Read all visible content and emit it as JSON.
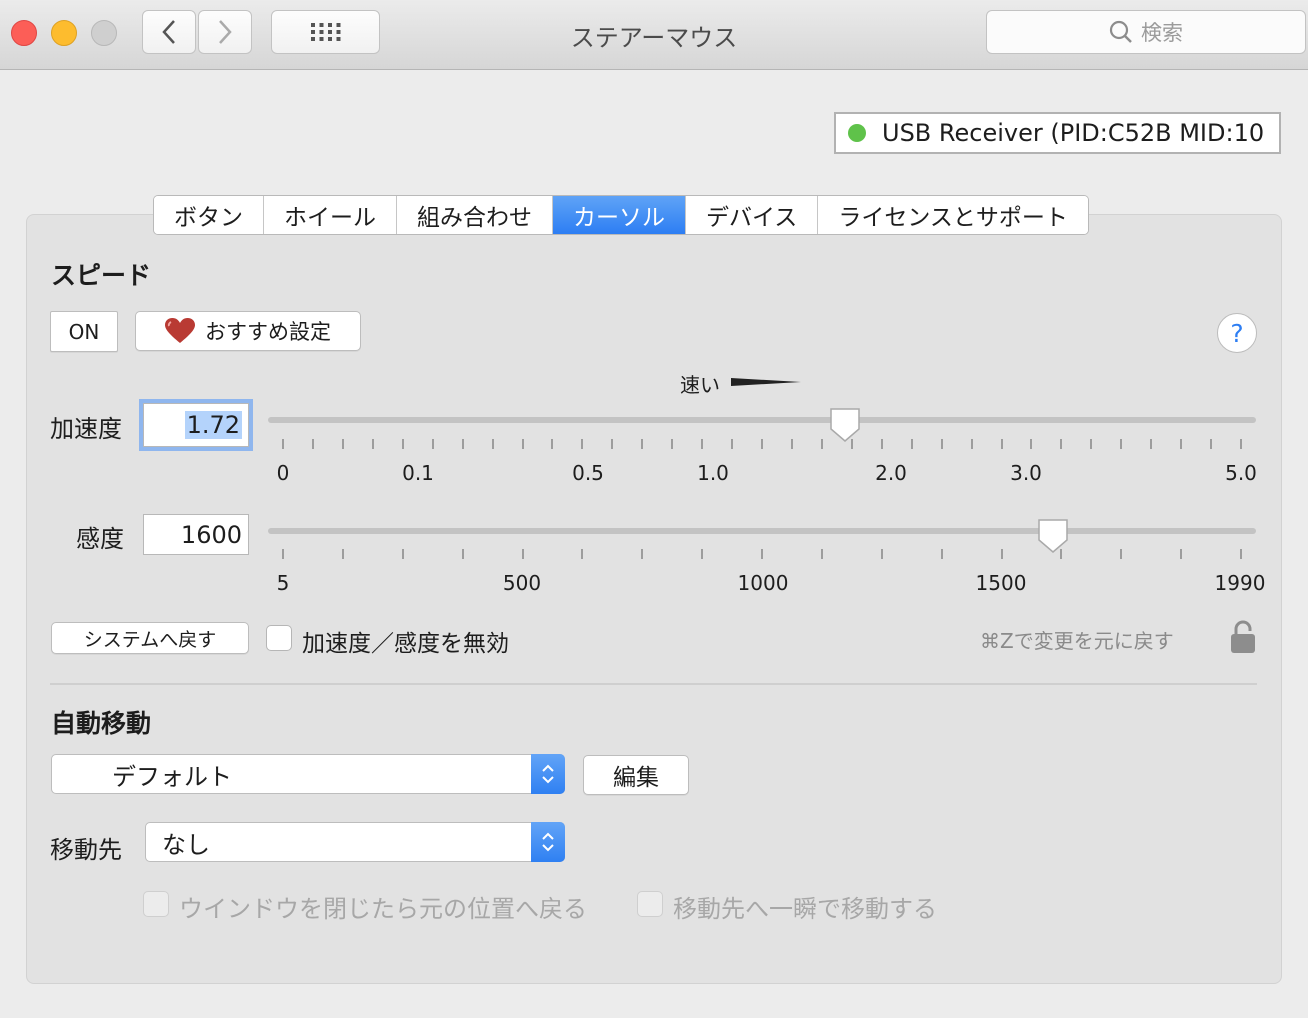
{
  "window": {
    "title": "ステアーマウス",
    "search_placeholder": "検索"
  },
  "device": {
    "label": "USB Receiver (PID:C52B MID:10",
    "status_color": "#5fc24a"
  },
  "tabs": [
    {
      "label": "ボタン",
      "active": false
    },
    {
      "label": "ホイール",
      "active": false
    },
    {
      "label": "組み合わせ",
      "active": false
    },
    {
      "label": "カーソル",
      "active": true
    },
    {
      "label": "デバイス",
      "active": false
    },
    {
      "label": "ライセンスとサポート",
      "active": false
    }
  ],
  "speed": {
    "heading": "スピード",
    "on_label": "ON",
    "recommended_label": "おすすめ設定",
    "help_label": "?",
    "fast_label": "速い",
    "acceleration": {
      "label": "加速度",
      "value": "1.72",
      "tick_labels": [
        "0",
        "0.1",
        "0.5",
        "1.0",
        "2.0",
        "3.0",
        "5.0"
      ]
    },
    "sensitivity": {
      "label": "感度",
      "value": "1600",
      "tick_labels": [
        "5",
        "500",
        "1000",
        "1500",
        "1990"
      ]
    },
    "reset_label": "システムへ戻す",
    "disable_label": "加速度／感度を無効",
    "undo_hint": "⌘Zで変更を元に戻す"
  },
  "auto_move": {
    "heading": "自動移動",
    "preset_value": "デフォルト",
    "edit_label": "編集",
    "destination_label": "移動先",
    "destination_value": "なし",
    "return_label": "ウインドウを閉じたら元の位置へ戻る",
    "instant_label": "移動先へ一瞬で移動する"
  },
  "colors": {
    "accent": "#2d7ef3"
  }
}
